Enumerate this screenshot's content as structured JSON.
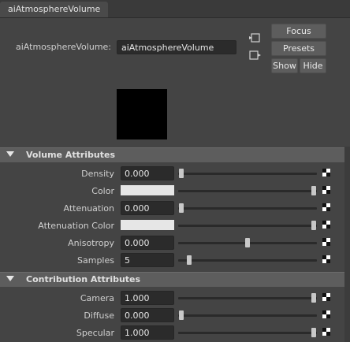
{
  "tab": {
    "label": "aiAtmosphereVolume"
  },
  "node": {
    "label": "aiAtmosphereVolume:",
    "value": "aiAtmosphereVolume"
  },
  "buttons": {
    "focus": "Focus",
    "presets": "Presets",
    "show": "Show",
    "hide": "Hide"
  },
  "sections": [
    {
      "title": "Volume Attributes",
      "rows": [
        {
          "label": "Density",
          "kind": "field",
          "value": "0.000",
          "slider": 0.02
        },
        {
          "label": "Color",
          "kind": "color",
          "color": "#e6e6e6",
          "slider": 0.98
        },
        {
          "label": "Attenuation",
          "kind": "field",
          "value": "0.000",
          "slider": 0.02
        },
        {
          "label": "Attenuation Color",
          "kind": "color",
          "color": "#e6e6e6",
          "slider": 0.98
        },
        {
          "label": "Anisotropy",
          "kind": "field",
          "value": "0.000",
          "slider": 0.5
        },
        {
          "label": "Samples",
          "kind": "field",
          "value": "5",
          "slider": 0.08
        }
      ]
    },
    {
      "title": "Contribution Attributes",
      "rows": [
        {
          "label": "Camera",
          "kind": "field",
          "value": "1.000",
          "slider": 0.98
        },
        {
          "label": "Diffuse",
          "kind": "field",
          "value": "0.000",
          "slider": 0.02
        },
        {
          "label": "Specular",
          "kind": "field",
          "value": "1.000",
          "slider": 0.98
        }
      ]
    }
  ]
}
